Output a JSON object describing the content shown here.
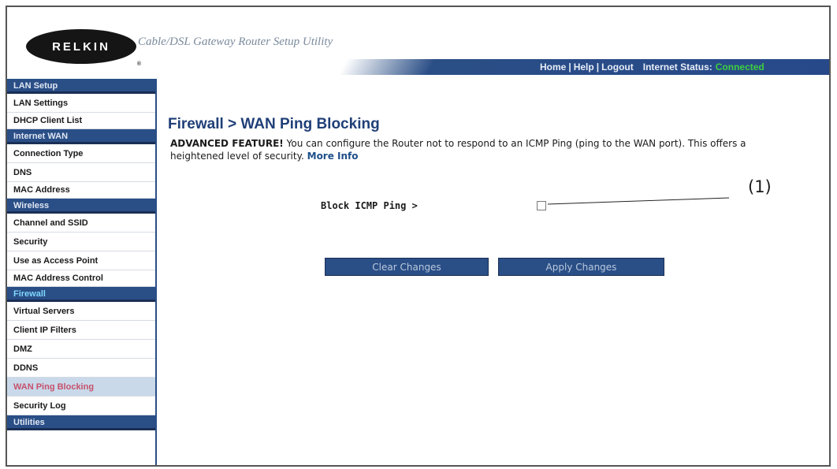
{
  "header": {
    "logo_text": "RELKIN",
    "app_title": "Cable/DSL Gateway Router Setup Utility",
    "links": {
      "home": "Home",
      "help": "Help",
      "logout": "Logout"
    },
    "status_label": "Internet Status:",
    "status_value": "Connected",
    "colors": {
      "nav_bar": "#2a4e86",
      "status_value": "#3ecf3e"
    }
  },
  "sidebar": {
    "sections": [
      {
        "title": "LAN Setup",
        "items": [
          "LAN Settings",
          "DHCP Client List"
        ]
      },
      {
        "title": "Internet WAN",
        "items": [
          "Connection Type",
          "DNS",
          "MAC Address"
        ]
      },
      {
        "title": "Wireless",
        "items": [
          "Channel and SSID",
          "Security",
          "Use as Access Point",
          "MAC Address Control"
        ]
      },
      {
        "title": "Firewall",
        "items": [
          "Virtual Servers",
          "Client IP Filters",
          "DMZ",
          "DDNS",
          "WAN Ping Blocking",
          "Security Log"
        ]
      },
      {
        "title": "Utilities",
        "items": []
      }
    ],
    "active_item": "WAN Ping Blocking"
  },
  "main": {
    "title": "Firewall > WAN Ping Blocking",
    "advanced_label": "ADVANCED FEATURE!",
    "description": " You can configure the Router not to respond to an ICMP Ping (ping to the WAN port). This offers a heightened level of security. ",
    "more_info": "More Info",
    "field_label": "Block ICMP Ping >",
    "checkbox_checked": false,
    "callout": "(1)",
    "buttons": {
      "clear": "Clear Changes",
      "apply": "Apply Changes"
    }
  }
}
